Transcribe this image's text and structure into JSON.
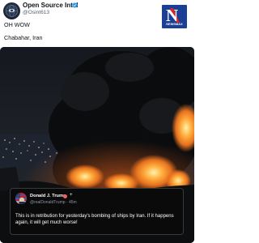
{
  "post": {
    "author_name": "Open Source Intel",
    "author_handle": "@Osint613",
    "text_line1": "OH WOW",
    "text_line2": "Chabahar, Iran"
  },
  "logo": {
    "letter": "N",
    "text": "NEWSMAX"
  },
  "embedded_post": {
    "author_name": "Donald J. Trump",
    "plus": "+",
    "handle": "@realDonaldTrump · 45m",
    "text": "This is in retribution for yesterday's bombing of ships by Iran. If it happens again, it will get much worse!"
  },
  "colors": {
    "verified_blue": "#1d9bf0",
    "newsmax_blue": "#1b3f95",
    "newsmax_red": "#d8262c",
    "fire_orange": "#e8731f"
  }
}
